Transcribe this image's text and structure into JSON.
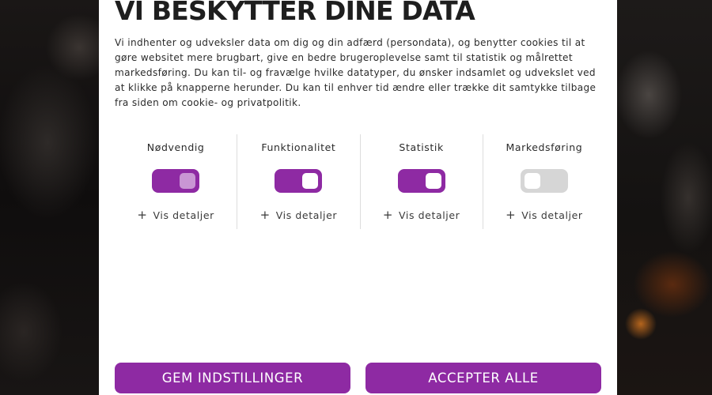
{
  "consent": {
    "title": "VI BESKYTTER DINE DATA",
    "intro": "Vi indhenter og udveksler data om dig og din adfærd (persondata), og benytter cookies til at gøre websitet mere brugbart, give en bedre brugeroplevelse samt til statistik og målrettet markedsføring. Du kan til- og fravælge hvilke datatyper, du ønsker indsamlet og udvekslet ved at klikke på knapperne herunder. Du kan til enhver tid ændre eller trække dit samtykke tilbage fra siden om cookie- og privatpolitik.",
    "categories": [
      {
        "label": "Nødvendig",
        "enabled": true,
        "locked": true,
        "details": "Vis detaljer"
      },
      {
        "label": "Funktionalitet",
        "enabled": true,
        "locked": false,
        "details": "Vis detaljer"
      },
      {
        "label": "Statistik",
        "enabled": true,
        "locked": false,
        "details": "Vis detaljer"
      },
      {
        "label": "Markedsføring",
        "enabled": false,
        "locked": false,
        "details": "Vis detaljer"
      }
    ],
    "save_button": "GEM INDSTILLINGER",
    "accept_button": "ACCEPTER ALLE"
  },
  "colors": {
    "accent": "#8e2aa3",
    "toggle_off": "#d6d6d6",
    "locked_knob": "#c996d4"
  },
  "icons": {
    "expand": "plus-icon"
  }
}
